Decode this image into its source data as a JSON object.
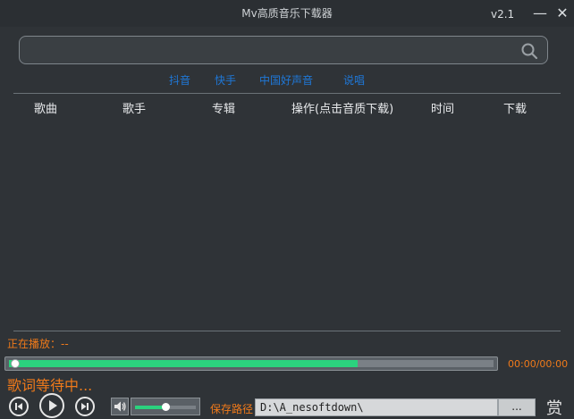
{
  "window": {
    "title": "Mv高质音乐下载器",
    "version": "v2.1",
    "minimize_glyph": "—",
    "close_glyph": "✕"
  },
  "search": {
    "value": "",
    "placeholder": "",
    "icon": "search-icon"
  },
  "platforms": [
    "抖音",
    "快手",
    "中国好声音",
    "说唱"
  ],
  "table": {
    "columns": [
      "歌曲",
      "歌手",
      "专辑",
      "操作(点击音质下载)",
      "时间",
      "下载"
    ],
    "rows": []
  },
  "player": {
    "now_playing_label": "正在播放：--",
    "progress_fraction": 0.72,
    "time": "00:00/00:00",
    "lyrics": "歌词等待中...",
    "volume_fraction": 0.5
  },
  "save": {
    "label": "保存路径",
    "path": "D:\\A_nesoftdown\\",
    "browse_label": "...",
    "reward_label": "赏"
  },
  "colors": {
    "background": "#2f3337",
    "accent_orange": "#f07a1a",
    "accent_green": "#2bd27e",
    "link_blue": "#1f78d8"
  }
}
